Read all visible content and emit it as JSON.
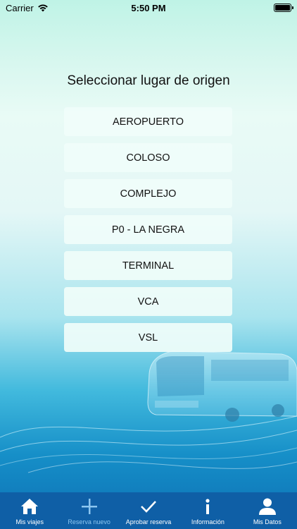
{
  "status_bar": {
    "carrier": "Carrier",
    "time": "5:50 PM"
  },
  "page": {
    "title": "Seleccionar lugar de origen"
  },
  "options": [
    {
      "label": "AEROPUERTO"
    },
    {
      "label": "COLOSO"
    },
    {
      "label": "COMPLEJO"
    },
    {
      "label": "P0 - LA NEGRA"
    },
    {
      "label": "TERMINAL"
    },
    {
      "label": "VCA"
    },
    {
      "label": "VSL"
    }
  ],
  "tabs": [
    {
      "label": "Mis viajes",
      "icon": "home-icon"
    },
    {
      "label": "Reserva nuevo",
      "icon": "plus-icon"
    },
    {
      "label": "Aprobar reserva",
      "icon": "checkmark-icon"
    },
    {
      "label": "Información",
      "icon": "info-icon"
    },
    {
      "label": "Mis Datos",
      "icon": "person-icon"
    }
  ],
  "colors": {
    "tab_bar": "#0f5fa6",
    "active_tab_label": "#8cc6f0"
  }
}
